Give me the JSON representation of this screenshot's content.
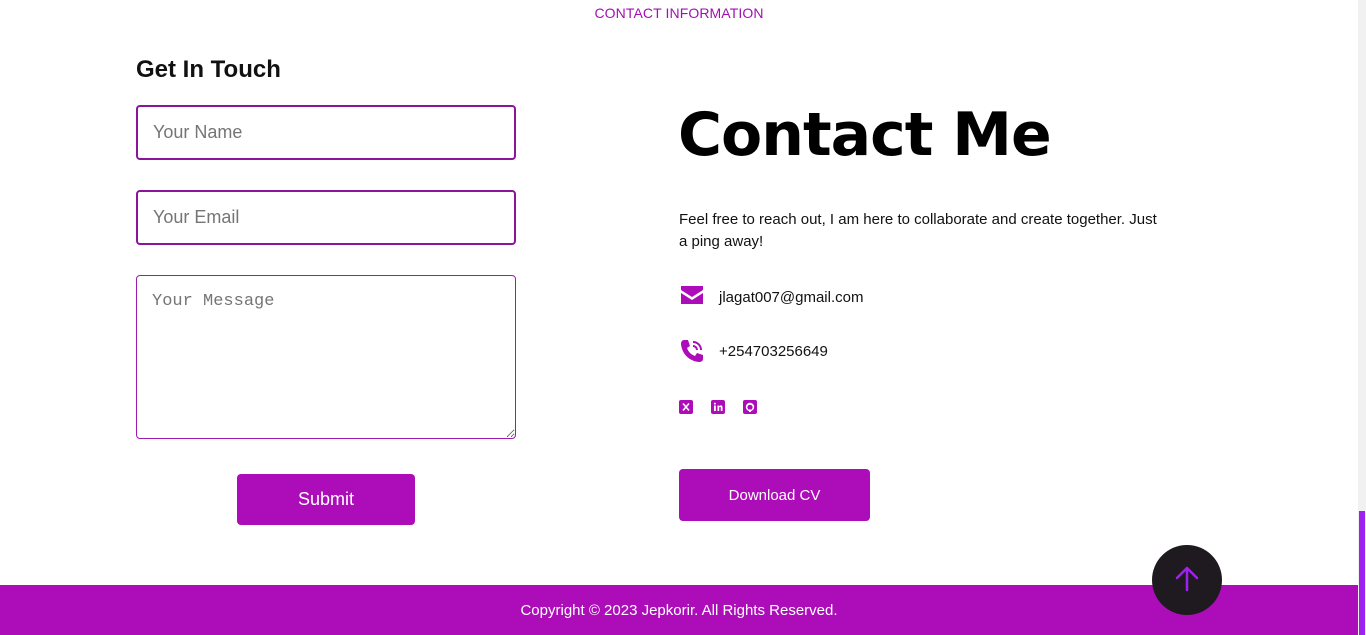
{
  "section": {
    "label": "CONTACT INFORMATION"
  },
  "form": {
    "heading": "Get In Touch",
    "name_placeholder": "Your Name",
    "email_placeholder": "Your Email",
    "message_placeholder": "Your Message",
    "submit_label": "Submit"
  },
  "contact": {
    "heading": "Contact Me",
    "intro": "Feel free to reach out, I am here to collaborate and create together. Just a ping away!",
    "email": "jlagat007@gmail.com",
    "phone": "+254703256649",
    "socials": [
      "x-icon",
      "linkedin-icon",
      "github-icon"
    ],
    "cv_label": "Download CV"
  },
  "footer": {
    "copyright": "Copyright © 2023 Jepkorir. All Rights Reserved."
  },
  "colors": {
    "accent": "#ad0db8",
    "field_border": "#8a1599",
    "scroll_button": "#1e1a1f",
    "scroll_arrow": "#a020f0"
  }
}
